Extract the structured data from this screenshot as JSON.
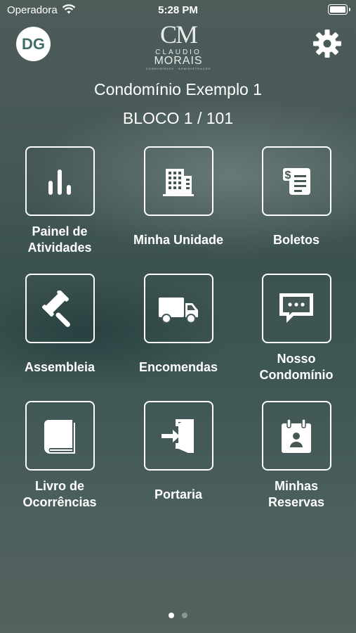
{
  "status_bar": {
    "carrier": "Operadora",
    "time": "5:28 PM"
  },
  "header": {
    "avatar_initials": "DG",
    "logo": {
      "monogram": "CM",
      "brand_line1": "CLAUDIO",
      "brand_line2": "MORAIS",
      "tagline": "CONDOMÍNIOS · ADMINISTRAÇÃO"
    },
    "settings_icon": "gear-icon"
  },
  "condo": {
    "name": "Condomínio Exemplo 1",
    "unit": "BLOCO 1 / 101"
  },
  "menu": {
    "items": [
      {
        "id": "painel",
        "label": "Painel de\nAtividades",
        "icon": "bar-chart-icon"
      },
      {
        "id": "unidade",
        "label": "Minha Unidade",
        "icon": "building-icon"
      },
      {
        "id": "boletos",
        "label": "Boletos",
        "icon": "invoice-icon"
      },
      {
        "id": "assembleia",
        "label": "Assembleia",
        "icon": "gavel-icon"
      },
      {
        "id": "encomendas",
        "label": "Encomendas",
        "icon": "truck-icon"
      },
      {
        "id": "nosso",
        "label": "Nosso\nCondomínio",
        "icon": "chat-bubble-icon"
      },
      {
        "id": "livro",
        "label": "Livro de\nOcorrências",
        "icon": "book-icon"
      },
      {
        "id": "portaria",
        "label": "Portaria",
        "icon": "door-enter-icon"
      },
      {
        "id": "reservas",
        "label": "Minhas\nReservas",
        "icon": "calendar-person-icon"
      }
    ]
  },
  "pager": {
    "pages": 2,
    "current": 1
  }
}
